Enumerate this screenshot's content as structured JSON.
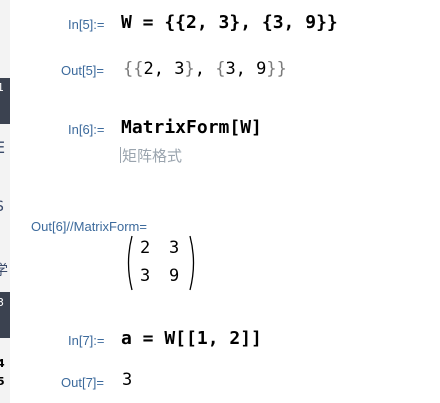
{
  "cells": [
    {
      "in_label": "In[5]:=",
      "input": "W = {{2, 3}, {3, 9}}",
      "out_label": "Out[5]=",
      "output_tokens": [
        "{",
        "{",
        "2, 3",
        "}",
        ", ",
        "{",
        "3, 9",
        "}",
        "}"
      ]
    },
    {
      "in_label": "In[6]:=",
      "input": "MatrixForm[W]",
      "autocomplete_hint": "矩阵格式",
      "out_label": "Out[6]//MatrixForm=",
      "matrix": [
        [
          "2",
          "3"
        ],
        [
          "3",
          "9"
        ]
      ]
    },
    {
      "in_label": "In[7]:=",
      "input": "a = W[[1, 2]]",
      "out_label": "Out[7]=",
      "output": "3"
    }
  ],
  "left_strip": {
    "fragments": [
      "1",
      "E",
      "S",
      "学",
      "3",
      "4",
      "5"
    ]
  },
  "colors": {
    "label": "#3c6a9c",
    "hint": "#9aa4ae",
    "brace": "#7a7a7a",
    "strip_dark": "#3b4250"
  }
}
